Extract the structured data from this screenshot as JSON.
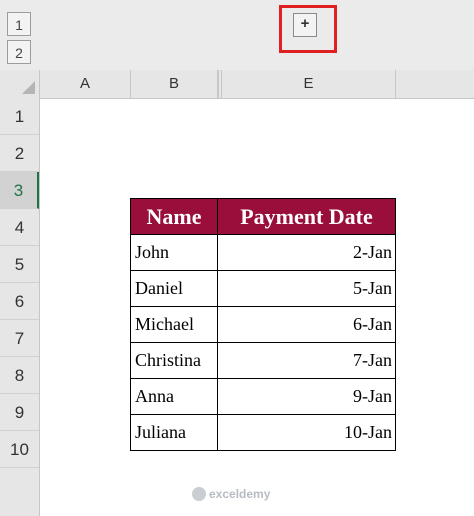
{
  "outline": {
    "levels": [
      "1",
      "2"
    ],
    "expand_symbol": "+"
  },
  "columns": [
    "A",
    "B",
    "E"
  ],
  "rows": [
    "1",
    "2",
    "3",
    "4",
    "5",
    "6",
    "7",
    "8",
    "9",
    "10"
  ],
  "active_row": "3",
  "table": {
    "headers": [
      "Name",
      "Payment Date"
    ],
    "rows": [
      {
        "name": "John",
        "date": "2-Jan"
      },
      {
        "name": "Daniel",
        "date": "5-Jan"
      },
      {
        "name": "Michael",
        "date": "6-Jan"
      },
      {
        "name": "Christina",
        "date": "7-Jan"
      },
      {
        "name": "Anna",
        "date": "9-Jan"
      },
      {
        "name": "Juliana",
        "date": "10-Jan"
      }
    ]
  },
  "colors": {
    "header_fill": "#9a0e3b",
    "highlight": "#e02020",
    "active_row": "#217346"
  },
  "watermark": "exceldemy"
}
